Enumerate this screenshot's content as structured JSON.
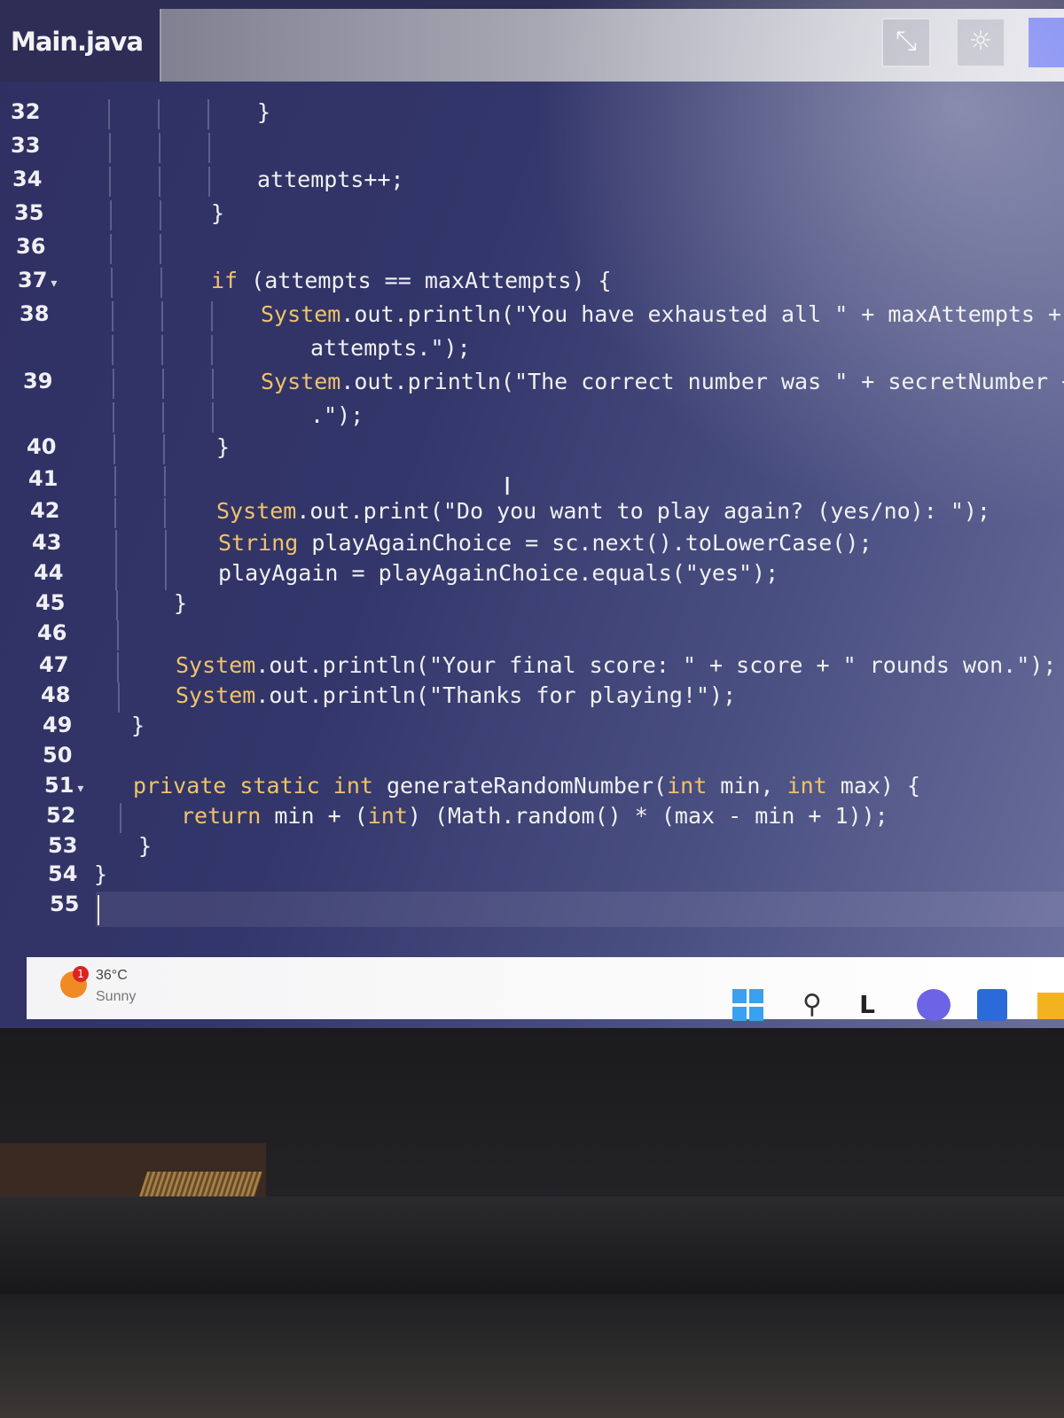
{
  "editor": {
    "file_title": "Main.java",
    "buttons": {
      "collapse_icon": "⤡",
      "theme_icon": "☼"
    }
  },
  "code_lines": [
    {
      "n": "32",
      "fold": false,
      "text": "}"
    },
    {
      "n": "33",
      "fold": false,
      "text": ""
    },
    {
      "n": "34",
      "fold": false,
      "text": "attempts++;"
    },
    {
      "n": "35",
      "fold": false,
      "text": "}"
    },
    {
      "n": "36",
      "fold": false,
      "text": ""
    },
    {
      "n": "37",
      "fold": true,
      "text": "if (attempts == maxAttempts) {"
    },
    {
      "n": "38",
      "fold": false,
      "text": "System.out.println(\"You have exhausted all \" + maxAttempts + \""
    },
    {
      "n": "",
      "fold": false,
      "text": "attempts.\");"
    },
    {
      "n": "39",
      "fold": false,
      "text": "System.out.println(\"The correct number was \" + secretNumber + \""
    },
    {
      "n": "",
      "fold": false,
      "text": ".\");"
    },
    {
      "n": "40",
      "fold": false,
      "text": "}"
    },
    {
      "n": "41",
      "fold": false,
      "text": ""
    },
    {
      "n": "42",
      "fold": false,
      "text": "System.out.print(\"Do you want to play again? (yes/no): \");"
    },
    {
      "n": "43",
      "fold": false,
      "text": "String playAgainChoice = sc.next().toLowerCase();"
    },
    {
      "n": "44",
      "fold": false,
      "text": "playAgain = playAgainChoice.equals(\"yes\");"
    },
    {
      "n": "45",
      "fold": false,
      "text": "}"
    },
    {
      "n": "46",
      "fold": false,
      "text": ""
    },
    {
      "n": "47",
      "fold": false,
      "text": "System.out.println(\"Your final score: \" + score + \" rounds won.\");"
    },
    {
      "n": "48",
      "fold": false,
      "text": "System.out.println(\"Thanks for playing!\");"
    },
    {
      "n": "49",
      "fold": false,
      "text": "}"
    },
    {
      "n": "50",
      "fold": false,
      "text": ""
    },
    {
      "n": "51",
      "fold": true,
      "text": "private static int generateRandomNumber(int min, int max) {"
    },
    {
      "n": "52",
      "fold": false,
      "text": "return min + (int) (Math.random() * (max - min + 1));"
    },
    {
      "n": "53",
      "fold": false,
      "text": "}"
    },
    {
      "n": "54",
      "fold": false,
      "text": "}"
    },
    {
      "n": "55",
      "fold": false,
      "text": ""
    }
  ],
  "taskbar": {
    "weather": {
      "temperature": "36°C",
      "condition": "Sunny",
      "badge": "1"
    },
    "icons": [
      "start-icon",
      "search-icon",
      "widgets-icon",
      "meet-icon",
      "store-icon",
      "folder-icon"
    ]
  },
  "colors": {
    "editor_bg": "#2f2f62",
    "keyword": "#f0c36a",
    "text": "#f1f1f1",
    "accent": "#6e7af0"
  }
}
